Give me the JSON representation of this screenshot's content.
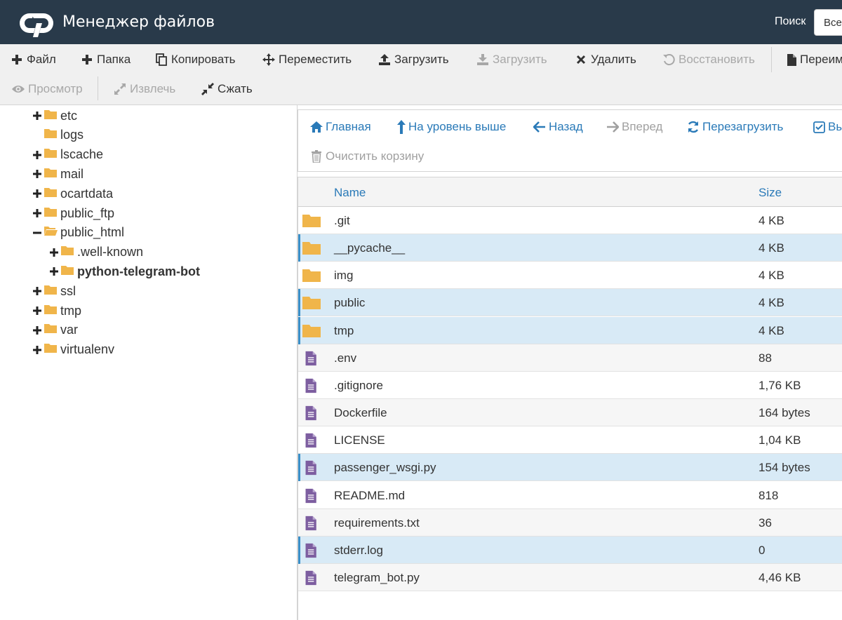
{
  "header": {
    "title": "Менеджер файлов",
    "search_label": "Поиск",
    "search_select_value": "Все"
  },
  "toolbar": {
    "row1": [
      {
        "label": "Файл",
        "icon": "plus-icon",
        "disabled": false
      },
      {
        "label": "Папка",
        "icon": "plus-icon",
        "disabled": false
      },
      {
        "label": "Копировать",
        "icon": "copy-icon",
        "disabled": false
      },
      {
        "label": "Переместить",
        "icon": "move-icon",
        "disabled": false
      },
      {
        "label": "Загрузить",
        "icon": "upload-icon",
        "disabled": false
      },
      {
        "label": "Загрузить",
        "icon": "download-icon",
        "disabled": true
      },
      {
        "label": "Удалить",
        "icon": "delete-icon",
        "disabled": false
      },
      {
        "label": "Восстановить",
        "icon": "restore-icon",
        "disabled": true
      },
      {
        "label": "Переим",
        "icon": "file-icon",
        "disabled": false
      }
    ],
    "row2": [
      {
        "label": "Просмотр",
        "icon": "eye-icon",
        "disabled": true
      },
      {
        "label": "Извлечь",
        "icon": "expand-icon",
        "disabled": true
      },
      {
        "label": "Сжать",
        "icon": "compress-icon",
        "disabled": false
      }
    ]
  },
  "tree": {
    "items": [
      {
        "label": "etc",
        "level": 0,
        "expander": "plus",
        "open": false,
        "bold": false
      },
      {
        "label": "logs",
        "level": 0,
        "expander": "none",
        "open": false,
        "bold": false
      },
      {
        "label": "lscache",
        "level": 0,
        "expander": "plus",
        "open": false,
        "bold": false
      },
      {
        "label": "mail",
        "level": 0,
        "expander": "plus",
        "open": false,
        "bold": false
      },
      {
        "label": "ocartdata",
        "level": 0,
        "expander": "plus",
        "open": false,
        "bold": false
      },
      {
        "label": "public_ftp",
        "level": 0,
        "expander": "plus",
        "open": false,
        "bold": false
      },
      {
        "label": "public_html",
        "level": 0,
        "expander": "minus",
        "open": true,
        "bold": false
      },
      {
        "label": ".well-known",
        "level": 1,
        "expander": "plus",
        "open": false,
        "bold": false
      },
      {
        "label": "python-telegram-bot",
        "level": 1,
        "expander": "plus",
        "open": false,
        "bold": true
      },
      {
        "label": "ssl",
        "level": 0,
        "expander": "plus",
        "open": false,
        "bold": false
      },
      {
        "label": "tmp",
        "level": 0,
        "expander": "plus",
        "open": false,
        "bold": false
      },
      {
        "label": "var",
        "level": 0,
        "expander": "plus",
        "open": false,
        "bold": false
      },
      {
        "label": "virtualenv",
        "level": 0,
        "expander": "plus",
        "open": false,
        "bold": false
      }
    ]
  },
  "navbar": {
    "row1": [
      {
        "label": "Главная",
        "icon": "home-icon",
        "disabled": false
      },
      {
        "label": "На уровень выше",
        "icon": "level-up-icon",
        "disabled": false
      },
      {
        "label": "Назад",
        "icon": "arrow-left-icon",
        "disabled": false
      },
      {
        "label": "Вперед",
        "icon": "arrow-right-icon",
        "disabled": true
      },
      {
        "label": "Перезагрузить",
        "icon": "refresh-icon",
        "disabled": false
      },
      {
        "label": "Вы",
        "icon": "checkbox-icon",
        "disabled": false
      }
    ],
    "row2": [
      {
        "label": "Очистить корзину",
        "icon": "trash-icon",
        "disabled": true
      }
    ]
  },
  "table": {
    "columns": {
      "name": "Name",
      "size": "Size"
    },
    "rows": [
      {
        "name": ".git",
        "size": "4 KB",
        "type": "folder",
        "selected": false
      },
      {
        "name": "__pycache__",
        "size": "4 KB",
        "type": "folder",
        "selected": true
      },
      {
        "name": "img",
        "size": "4 KB",
        "type": "folder",
        "selected": false
      },
      {
        "name": "public",
        "size": "4 KB",
        "type": "folder",
        "selected": true
      },
      {
        "name": "tmp",
        "size": "4 KB",
        "type": "folder",
        "selected": true
      },
      {
        "name": ".env",
        "size": "88",
        "type": "file",
        "selected": false
      },
      {
        "name": ".gitignore",
        "size": "1,76 KB",
        "type": "file",
        "selected": false
      },
      {
        "name": "Dockerfile",
        "size": "164 bytes",
        "type": "file",
        "selected": false
      },
      {
        "name": "LICENSE",
        "size": "1,04 KB",
        "type": "file",
        "selected": false
      },
      {
        "name": "passenger_wsgi.py",
        "size": "154 bytes",
        "type": "file",
        "selected": true
      },
      {
        "name": "README.md",
        "size": "818",
        "type": "file",
        "selected": false
      },
      {
        "name": "requirements.txt",
        "size": "36",
        "type": "file",
        "selected": false
      },
      {
        "name": "stderr.log",
        "size": "0",
        "type": "file",
        "selected": true
      },
      {
        "name": "telegram_bot.py",
        "size": "4,46 KB",
        "type": "file",
        "selected": false
      }
    ]
  },
  "colors": {
    "header_bg": "#293a4a",
    "link_blue": "#2a7ab8",
    "folder": "#f0b54a",
    "file": "#7d5ea0",
    "selected_row": "#d8eaf6",
    "selected_bar": "#3a8fc8"
  }
}
